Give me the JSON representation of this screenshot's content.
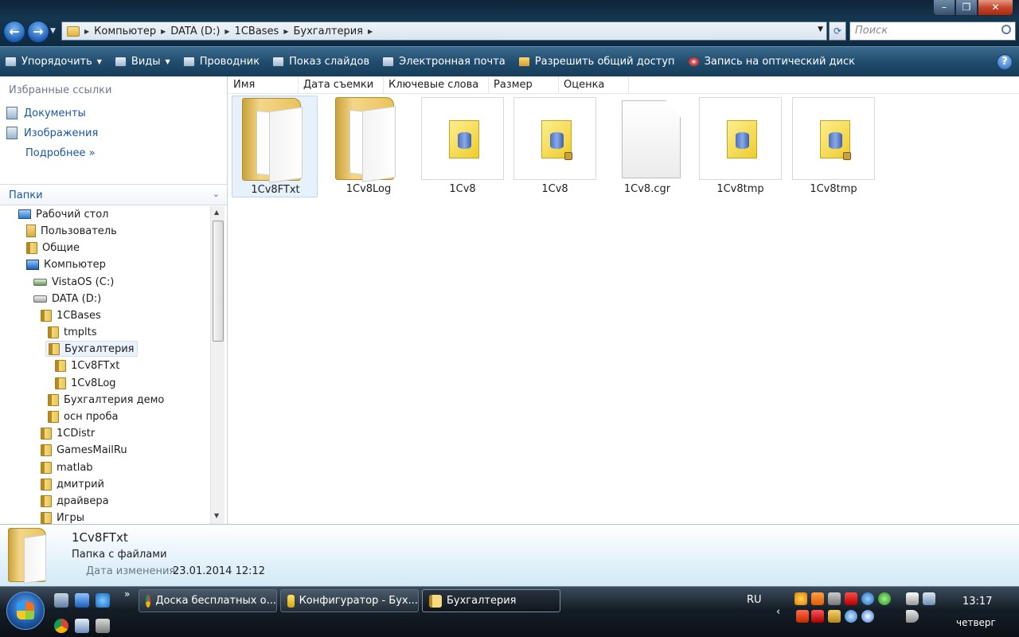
{
  "window": {
    "caption": {
      "minimize": "–",
      "maximize": "❐",
      "close": "✕"
    },
    "nav": {
      "back": "←",
      "forward": "→"
    },
    "breadcrumb": [
      "Компьютер",
      "DATA (D:)",
      "1CBases",
      "Бухгалтерия"
    ],
    "search_placeholder": "Поиск"
  },
  "toolbar": {
    "organize": "Упорядочить",
    "views": "Виды",
    "explorer": "Проводник",
    "slideshow": "Показ слайдов",
    "email": "Электронная почта",
    "share": "Разрешить общий доступ",
    "burn": "Запись на оптический диск",
    "help": "?"
  },
  "favorites": {
    "title": "Избранные ссылки",
    "items": [
      "Документы",
      "Изображения"
    ],
    "more": "Подробнее »"
  },
  "folders": {
    "title": "Папки",
    "tree": [
      {
        "label": "Рабочий стол"
      },
      {
        "label": "Пользователь"
      },
      {
        "label": "Общие"
      },
      {
        "label": "Компьютер"
      },
      {
        "label": "VistaOS (C:)"
      },
      {
        "label": "DATA (D:)"
      },
      {
        "label": "1CBases"
      },
      {
        "label": "tmplts"
      },
      {
        "label": "Бухгалтерия"
      },
      {
        "label": "1Cv8FTxt"
      },
      {
        "label": "1Cv8Log"
      },
      {
        "label": "Бухгалтерия демо"
      },
      {
        "label": "осн проба"
      },
      {
        "label": "1CDistr"
      },
      {
        "label": "GamesMailRu"
      },
      {
        "label": "matlab"
      },
      {
        "label": "дмитрий"
      },
      {
        "label": "драйвера"
      },
      {
        "label": "Игры"
      }
    ]
  },
  "columns": [
    "Имя",
    "Дата съемки",
    "Ключевые слова",
    "Размер",
    "Оценка"
  ],
  "files": [
    {
      "name": "1Cv8FTxt",
      "type": "folder"
    },
    {
      "name": "1Cv8Log",
      "type": "folder"
    },
    {
      "name": "1Cv8",
      "type": "database"
    },
    {
      "name": "1Cv8",
      "type": "database-locked"
    },
    {
      "name": "1Cv8.cgr",
      "type": "file"
    },
    {
      "name": "1Cv8tmp",
      "type": "database"
    },
    {
      "name": "1Cv8tmp",
      "type": "database-locked"
    }
  ],
  "details": {
    "name": "1Cv8FTxt",
    "type": "Папка с файлами",
    "date_label": "Дата изменения:",
    "date": "23.01.2014 12:12"
  },
  "taskbar": {
    "overflow": "»",
    "buttons": [
      {
        "label": "Доска бесплатных о...",
        "icon": "chrome-icon"
      },
      {
        "label": "Конфигуратор - Бух...",
        "icon": "1c-icon"
      },
      {
        "label": "Бухгалтерия",
        "icon": "folder-icon"
      }
    ],
    "language": "RU",
    "time": "13:17",
    "day": "четверг"
  },
  "colors": {
    "accent": "#1a56a6",
    "toolbar": "#1f4a6b",
    "selection": "#e6f1fb"
  }
}
